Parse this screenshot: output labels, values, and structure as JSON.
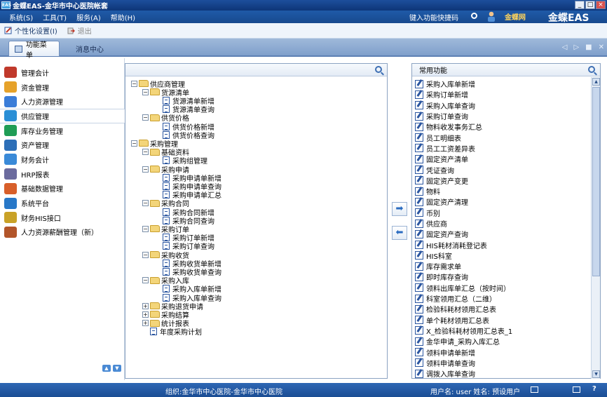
{
  "window": {
    "app_icon_text": "EAS",
    "title": "金蝶EAS-金华市中心医院帐套",
    "min": "_",
    "max": "□",
    "close": "×"
  },
  "menubar": {
    "items": [
      "系统(S)",
      "工具(T)",
      "服务(A)",
      "帮助(H)"
    ],
    "quick_code": "键入功能快捷码",
    "logo_k": "金蝶网",
    "brand": "金蝶EAS"
  },
  "toolbar": {
    "personalize": "个性化设置(I)",
    "exit": "退出"
  },
  "tabs": {
    "active": "功能菜单",
    "inactive": "消息中心"
  },
  "sidebar": {
    "items": [
      "管理会计",
      "资金管理",
      "人力资源管理",
      "供应管理",
      "库存业务管理",
      "资产管理",
      "财务会计",
      "HRP报表",
      "基础数据管理",
      "系统平台",
      "财务HIS接口",
      "人力资源薪酬管理（新）"
    ],
    "active_index": 3,
    "icon_colors": [
      "#c0392b",
      "#e6a22a",
      "#3b7dd8",
      "#2a8fd6",
      "#1f9d55",
      "#2d6fb8",
      "#3a8ad8",
      "#6b6b9e",
      "#d85f2a",
      "#2878c8",
      "#c9a227",
      "#b2552a"
    ]
  },
  "tree": {
    "nodes": [
      {
        "text": "供应商管理",
        "level": 0,
        "kind": "folder",
        "expand": "−"
      },
      {
        "text": "货源清单",
        "level": 1,
        "kind": "folder",
        "expand": "−"
      },
      {
        "text": "货源清单新增",
        "level": 2,
        "kind": "doc"
      },
      {
        "text": "货源清单查询",
        "level": 2,
        "kind": "doc"
      },
      {
        "text": "供货价格",
        "level": 1,
        "kind": "folder",
        "expand": "−"
      },
      {
        "text": "供货价格新增",
        "level": 2,
        "kind": "doc"
      },
      {
        "text": "供货价格查询",
        "level": 2,
        "kind": "doc"
      },
      {
        "text": "采购管理",
        "level": 0,
        "kind": "folder",
        "expand": "−"
      },
      {
        "text": "基础资料",
        "level": 1,
        "kind": "folder",
        "expand": "−"
      },
      {
        "text": "采购组管理",
        "level": 2,
        "kind": "doc"
      },
      {
        "text": "采购申请",
        "level": 1,
        "kind": "folder",
        "expand": "−"
      },
      {
        "text": "采购申请单新增",
        "level": 2,
        "kind": "doc"
      },
      {
        "text": "采购申请单查询",
        "level": 2,
        "kind": "doc"
      },
      {
        "text": "采购申请单汇总",
        "level": 2,
        "kind": "doc"
      },
      {
        "text": "采购合同",
        "level": 1,
        "kind": "folder",
        "expand": "−"
      },
      {
        "text": "采购合同新增",
        "level": 2,
        "kind": "doc"
      },
      {
        "text": "采购合同查询",
        "level": 2,
        "kind": "doc"
      },
      {
        "text": "采购订单",
        "level": 1,
        "kind": "folder",
        "expand": "−"
      },
      {
        "text": "采购订单新增",
        "level": 2,
        "kind": "doc"
      },
      {
        "text": "采购订单查询",
        "level": 2,
        "kind": "doc"
      },
      {
        "text": "采购收货",
        "level": 1,
        "kind": "folder",
        "expand": "−"
      },
      {
        "text": "采购收货单新增",
        "level": 2,
        "kind": "doc"
      },
      {
        "text": "采购收货单查询",
        "level": 2,
        "kind": "doc"
      },
      {
        "text": "采购入库",
        "level": 1,
        "kind": "folder",
        "expand": "−"
      },
      {
        "text": "采购入库单新增",
        "level": 2,
        "kind": "doc"
      },
      {
        "text": "采购入库单查询",
        "level": 2,
        "kind": "doc"
      },
      {
        "text": "采购退货申请",
        "level": 1,
        "kind": "folder",
        "expand": "+"
      },
      {
        "text": "采购结算",
        "level": 1,
        "kind": "folder",
        "expand": "+"
      },
      {
        "text": "统计报表",
        "level": 1,
        "kind": "folder",
        "expand": "+"
      },
      {
        "text": "年度采购计划",
        "level": 1,
        "kind": "doc"
      }
    ]
  },
  "arrows": {
    "add": "➡",
    "remove": "⬅"
  },
  "common": {
    "title": "常用功能",
    "items": [
      "采购入库单新增",
      "采购订单新增",
      "采购入库单查询",
      "采购订单查询",
      "物料收发事务汇总",
      "员工明细表",
      "员工工资差异表",
      "固定资产清单",
      "凭证查询",
      "固定资产变更",
      "物料",
      "固定资产清理",
      "币别",
      "供应商",
      "固定资产查询",
      "HIS耗材消耗登记表",
      "HIS科室",
      "库存需求单",
      "即时库存查询",
      "领料出库单汇总（按时间）",
      "科室领用汇总（二维）",
      "检验科耗材领用汇总表",
      "单个耗材领用汇总表",
      "X_检验科耗材领用汇总表_1",
      "金华申请_采购入库汇总",
      "领料申请单新增",
      "领料申请单查询",
      "调拨入库单查询"
    ]
  },
  "status": {
    "org": "组织:金华市中心医院-金华市中心医院",
    "user": "用户名: user 姓名: 预设用户",
    "help": "?"
  }
}
